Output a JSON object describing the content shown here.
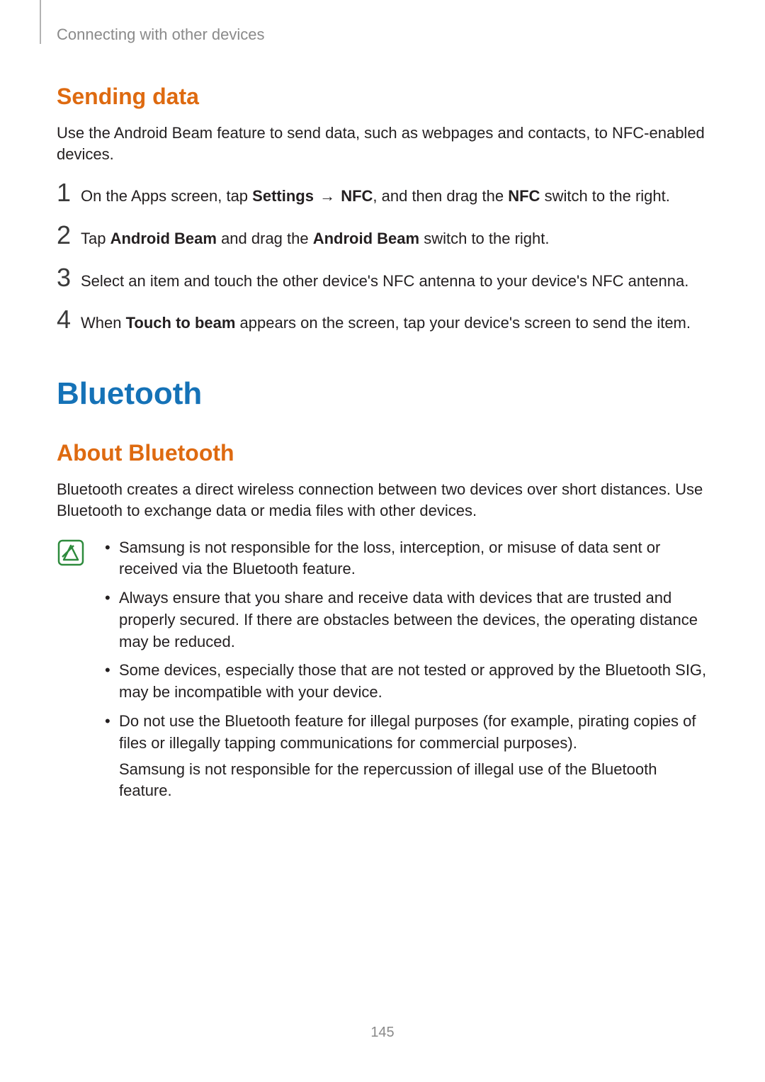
{
  "breadcrumb": "Connecting with other devices",
  "section1": {
    "heading": "Sending data",
    "intro": "Use the Android Beam feature to send data, such as webpages and contacts, to NFC-enabled devices.",
    "steps": [
      {
        "num": "1",
        "pre": "On the Apps screen, tap ",
        "b1": "Settings",
        "arrow": " → ",
        "b2": "NFC",
        "mid": ", and then drag the ",
        "b3": "NFC",
        "post": " switch to the right."
      },
      {
        "num": "2",
        "pre": "Tap ",
        "b1": "Android Beam",
        "mid": " and drag the ",
        "b2": "Android Beam",
        "post": " switch to the right."
      },
      {
        "num": "3",
        "text": "Select an item and touch the other device's NFC antenna to your device's NFC antenna."
      },
      {
        "num": "4",
        "pre": "When ",
        "b1": "Touch to beam",
        "post": " appears on the screen, tap your device's screen to send the item."
      }
    ]
  },
  "section2": {
    "title": "Bluetooth",
    "heading": "About Bluetooth",
    "intro": "Bluetooth creates a direct wireless connection between two devices over short distances. Use Bluetooth to exchange data or media files with other devices.",
    "bullets": [
      {
        "text": "Samsung is not responsible for the loss, interception, or misuse of data sent or received via the Bluetooth feature."
      },
      {
        "text": "Always ensure that you share and receive data with devices that are trusted and properly secured. If there are obstacles between the devices, the operating distance may be reduced."
      },
      {
        "text": "Some devices, especially those that are not tested or approved by the Bluetooth SIG, may be incompatible with your device."
      },
      {
        "text": "Do not use the Bluetooth feature for illegal purposes (for example, pirating copies of files or illegally tapping communications for commercial purposes).",
        "extra": "Samsung is not responsible for the repercussion of illegal use of the Bluetooth feature."
      }
    ]
  },
  "page_number": "145"
}
